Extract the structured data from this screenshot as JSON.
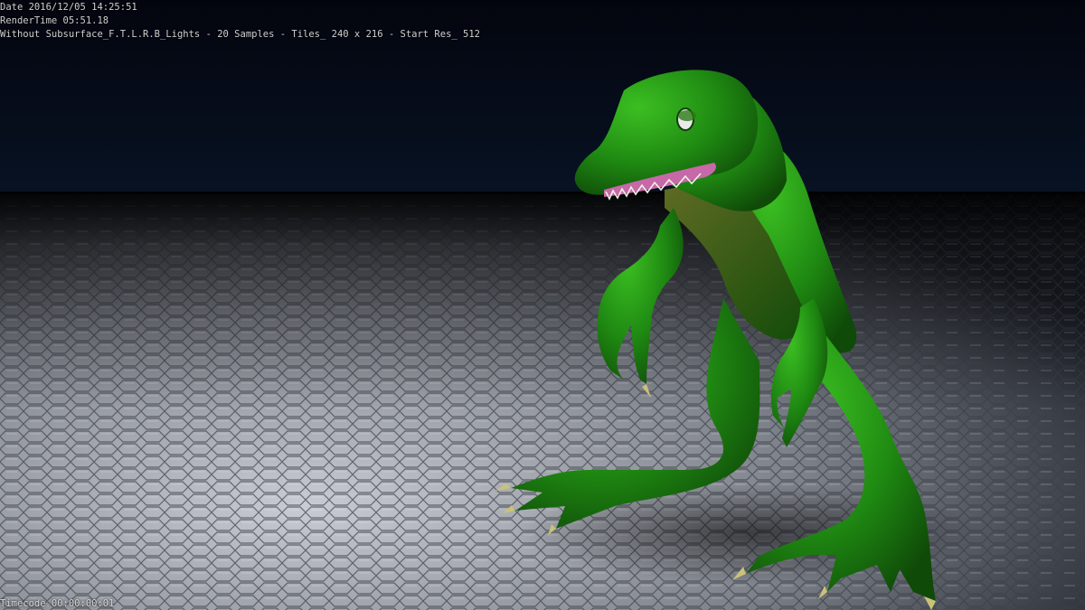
{
  "stamp": {
    "date": "Date 2016/12/05 14:25:51",
    "render_time": "RenderTime 05:51.18",
    "note": "Without Subsurface_F.T.L.R.B_Lights - 20 Samples - Tiles_ 240 x 216 - Start Res_ 512",
    "timecode": "Timecode 00:00:00:01"
  },
  "colors": {
    "sky_top": "#03050e",
    "sky_horizon": "#081324",
    "floor_lit": "#c9ccd3",
    "floor_mid": "#7d8189",
    "floor_far": "#1b1f27",
    "skin": "#1f8a12",
    "skin_highlight": "#3cbf22",
    "skin_shadow": "#0f4a08",
    "belly": "#5f6b23",
    "claw": "#c9c27a",
    "mouth": "#c768a8"
  }
}
